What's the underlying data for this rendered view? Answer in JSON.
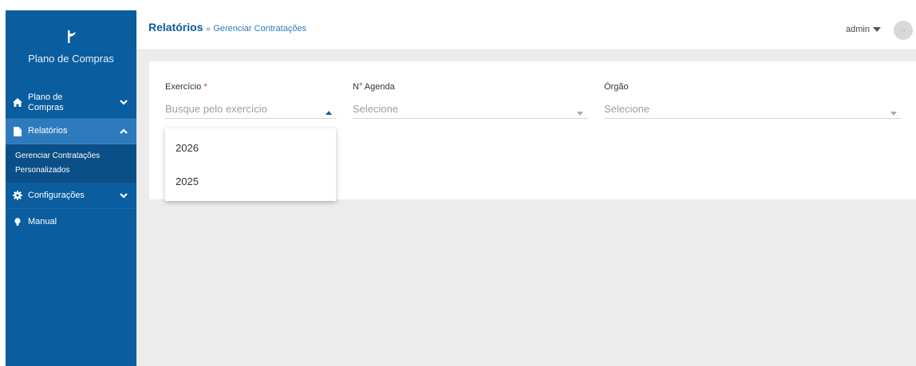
{
  "app": {
    "name": "Plano de Compras"
  },
  "colors": {
    "sidebar": "#0a5d9f",
    "sidebar_active": "#2d7bbd",
    "submenu": "#0a4f87",
    "required": "#d32f2f"
  },
  "sidebar": {
    "items": [
      {
        "label": "Plano de Compras",
        "icon": "home-icon",
        "chevron": "chevron-down-icon"
      },
      {
        "label": "Relatórios",
        "icon": "file-icon",
        "chevron": "chevron-up-icon",
        "active": true,
        "subitems": [
          {
            "label": "Gerenciar Contratações"
          },
          {
            "label": "Personalizados"
          }
        ]
      },
      {
        "label": "Configurações",
        "icon": "gear-icon",
        "chevron": "chevron-down-icon"
      },
      {
        "label": "Manual",
        "icon": "lightbulb-icon"
      }
    ]
  },
  "header": {
    "breadcrumb_main": "Relatórios",
    "breadcrumb_sep": "»",
    "breadcrumb_sub": "Gerenciar Contratações",
    "user": "admin",
    "avatar_text": "··"
  },
  "form": {
    "exercicio": {
      "label": "Exercício",
      "required_mark": "*",
      "placeholder": "Busque pelo exercício"
    },
    "agenda": {
      "label": "N° Agenda",
      "placeholder": "Selecione"
    },
    "orgao": {
      "label": "Órgão",
      "placeholder": "Selecione"
    }
  },
  "dropdown": {
    "options": [
      "2026",
      "2025"
    ]
  }
}
